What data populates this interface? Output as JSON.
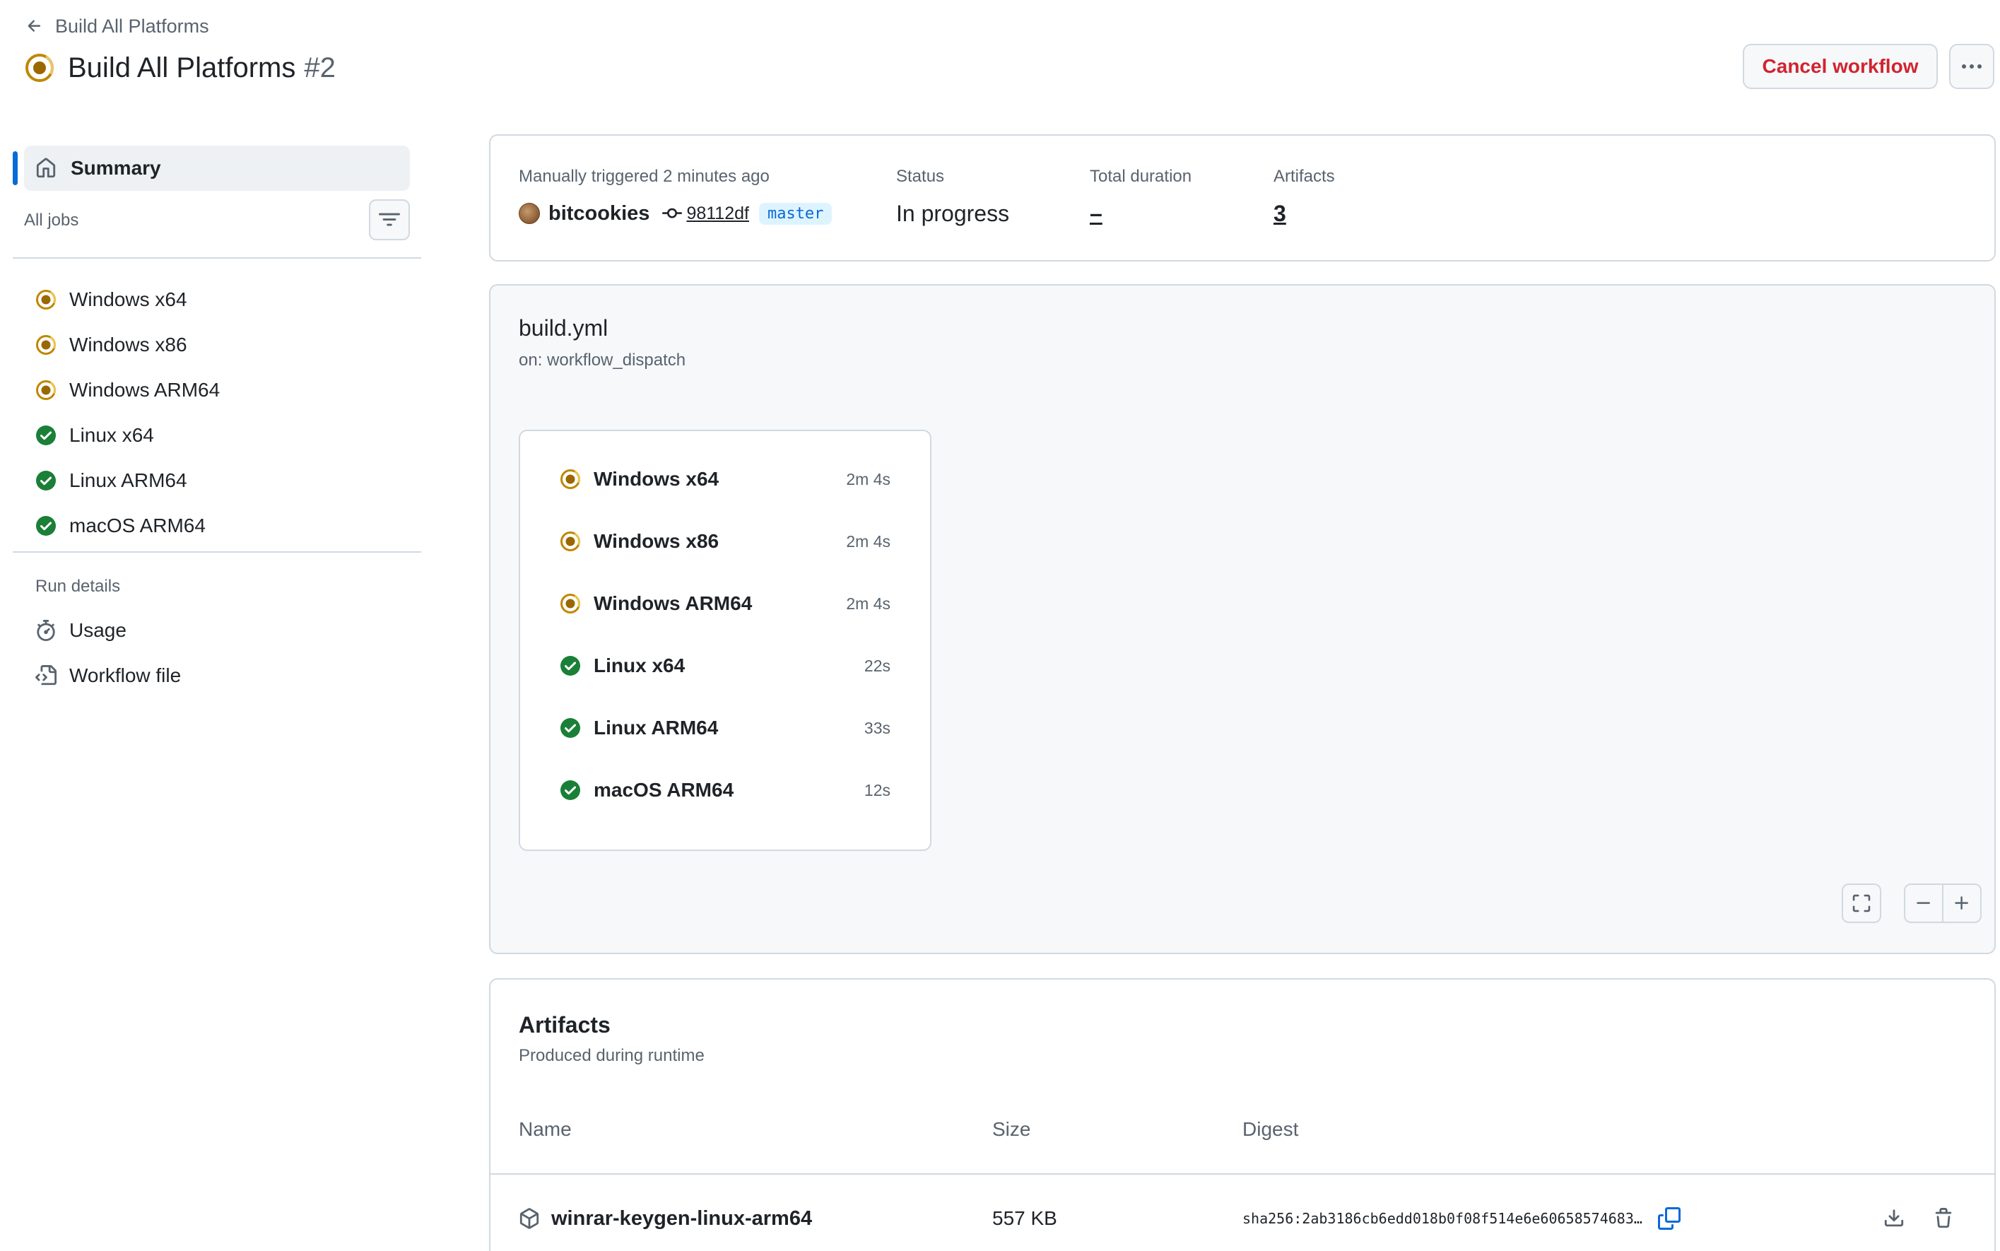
{
  "header": {
    "back_label": "Build All Platforms",
    "title": "Build All Platforms",
    "run_number": "#2",
    "cancel_label": "Cancel workflow"
  },
  "sidebar": {
    "summary_label": "Summary",
    "all_jobs_label": "All jobs",
    "jobs": [
      {
        "name": "Windows x64",
        "status": "in-progress"
      },
      {
        "name": "Windows x86",
        "status": "in-progress"
      },
      {
        "name": "Windows ARM64",
        "status": "in-progress"
      },
      {
        "name": "Linux x64",
        "status": "success"
      },
      {
        "name": "Linux ARM64",
        "status": "success"
      },
      {
        "name": "macOS ARM64",
        "status": "success"
      }
    ],
    "run_details_label": "Run details",
    "details": [
      {
        "label": "Usage",
        "icon": "stopwatch-icon"
      },
      {
        "label": "Workflow file",
        "icon": "file-code-icon"
      }
    ]
  },
  "summary": {
    "trigger_label": "Manually triggered 2 minutes ago",
    "actor": "bitcookies",
    "commit_sha": "98112df",
    "branch": "master",
    "status_label": "Status",
    "status_value": "In progress",
    "duration_label": "Total duration",
    "duration_value": "–",
    "artifacts_label": "Artifacts",
    "artifacts_value": "3"
  },
  "graph": {
    "file": "build.yml",
    "trigger": "on: workflow_dispatch",
    "jobs": [
      {
        "name": "Windows x64",
        "duration": "2m 4s",
        "status": "in-progress"
      },
      {
        "name": "Windows x86",
        "duration": "2m 4s",
        "status": "in-progress"
      },
      {
        "name": "Windows ARM64",
        "duration": "2m 4s",
        "status": "in-progress"
      },
      {
        "name": "Linux x64",
        "duration": "22s",
        "status": "success"
      },
      {
        "name": "Linux ARM64",
        "duration": "33s",
        "status": "success"
      },
      {
        "name": "macOS ARM64",
        "duration": "12s",
        "status": "success"
      }
    ]
  },
  "artifacts": {
    "title": "Artifacts",
    "subtitle": "Produced during runtime",
    "columns": {
      "name": "Name",
      "size": "Size",
      "digest": "Digest"
    },
    "rows": [
      {
        "name": "winrar-keygen-linux-arm64",
        "size": "557 KB",
        "digest": "sha256:2ab3186cb6edd018b0f08f514e6e60658574683…"
      }
    ]
  },
  "colors": {
    "in_progress": "#9a6700",
    "success": "#1a7f37",
    "danger": "#d1242f",
    "accent": "#0969da"
  }
}
